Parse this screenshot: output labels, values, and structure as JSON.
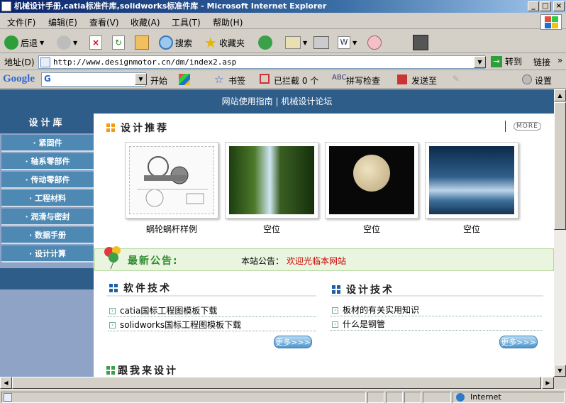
{
  "window": {
    "title": "机械设计手册,catia标准件库,solidworks标准件库 - Microsoft Internet Explorer",
    "buttons": [
      "_",
      "□",
      "×"
    ]
  },
  "menu": [
    "文件(F)",
    "编辑(E)",
    "查看(V)",
    "收藏(A)",
    "工具(T)",
    "帮助(H)"
  ],
  "toolbar": {
    "back": "后退",
    "search": "搜索",
    "favorites": "收藏夹"
  },
  "address": {
    "label": "地址(D)",
    "url": "http://www.designmotor.cn/dm/index2.asp",
    "go": "转到",
    "links": "链接"
  },
  "googlebar": {
    "logo": "Google",
    "start": "开始",
    "bookmarks": "书签",
    "blocked": "已拦截 0 个",
    "spell": "拼写检查",
    "send": "发送至",
    "settings": "设置"
  },
  "page": {
    "topnav": "网站使用指南 | 机械设计论坛",
    "sidebar": {
      "title": "设计库",
      "items": [
        "· 紧固件",
        "· 轴系零部件",
        "· 传动零部件",
        "· 工程材料",
        "· 润滑与密封",
        "· 数据手册",
        "· 设计计算"
      ]
    },
    "recommend": {
      "title": "设计推荐",
      "more": "MORE",
      "items": [
        "蜗轮蜗杆样例",
        "空位",
        "空位",
        "空位"
      ]
    },
    "notice": {
      "title": "最新公告:",
      "label": "本站公告：",
      "text": "欢迎光临本网站"
    },
    "software": {
      "title": "软件技术",
      "links": [
        "catia国标工程图模板下载",
        "solidworks国标工程图模板下载"
      ],
      "more": "更多>>>"
    },
    "design": {
      "title": "设计技术",
      "links": [
        "板材的有关实用知识",
        "什么是钢管"
      ],
      "more": "更多>>>"
    },
    "follow": {
      "title": "跟我来设计"
    }
  },
  "status": {
    "zone": "Internet"
  },
  "colors": {
    "accent": "#2f5d8a",
    "notice_red": "#cc0000"
  }
}
